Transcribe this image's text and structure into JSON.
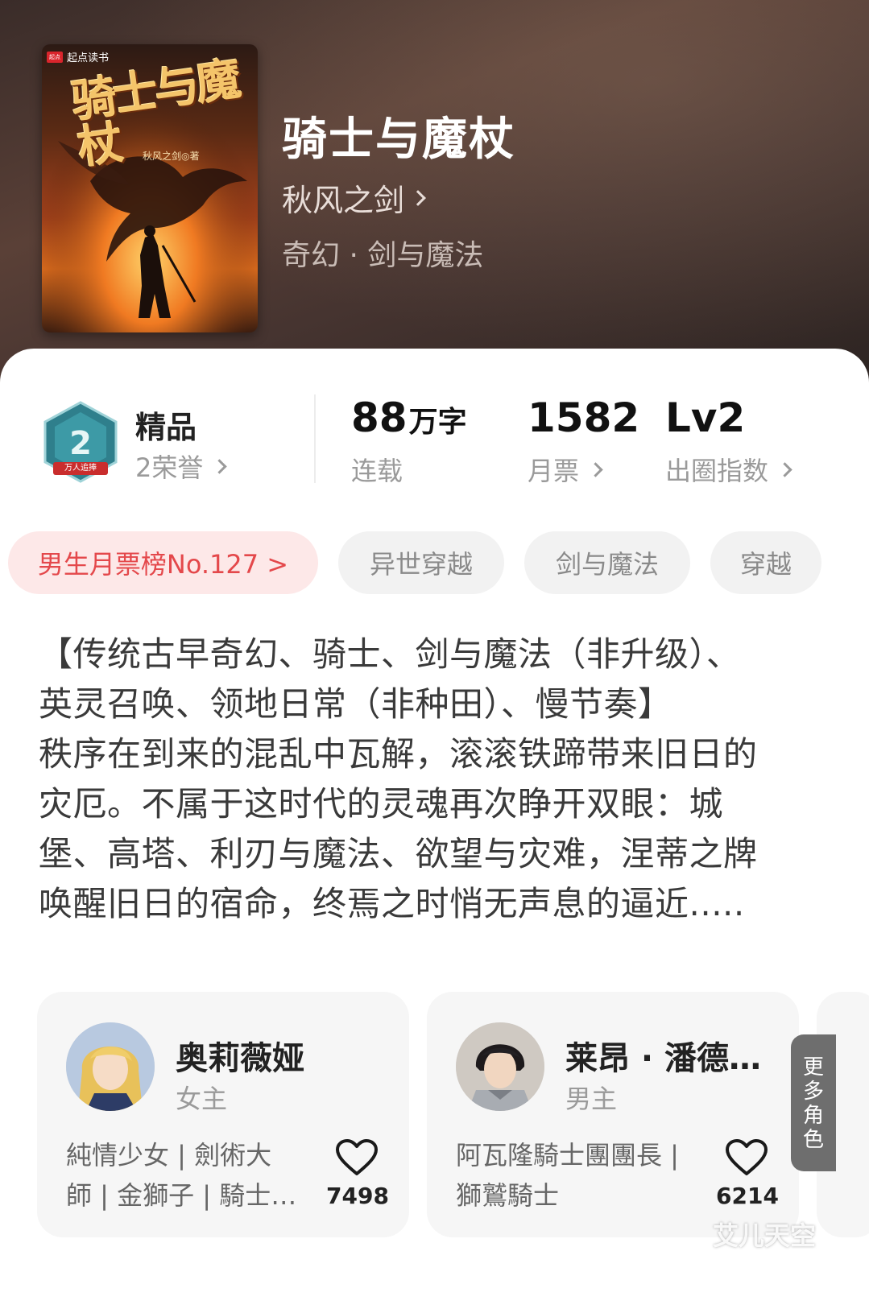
{
  "book": {
    "cover_publisher_logo": "起点",
    "cover_publisher": "起点读书",
    "cover_title": "骑士与魔杖",
    "cover_author": "秋风之剑◎著",
    "title": "骑士与魔杖",
    "author": "秋风之剑",
    "genre": "奇幻 · 剑与魔法"
  },
  "stats": {
    "badge_text": "万人追捧",
    "quality_title": "精品",
    "honor_label": "2荣誉",
    "words_value": "88",
    "words_unit": "万字",
    "words_label": "连载",
    "tickets_value": "1582",
    "tickets_label": "月票",
    "level_value": "Lv2",
    "level_label": "出圈指数"
  },
  "chips": {
    "rank": "男生月票榜No.127 >",
    "tag1": "异世穿越",
    "tag2": "剑与魔法",
    "tag3": "穿越"
  },
  "synopsis": {
    "line1": "【传统古早奇幻、骑士、剑与魔法（非升级）、",
    "line2": "英灵召唤、领地日常（非种田）、慢节奏】",
    "line3": "秩序在到来的混乱中瓦解，滚滚铁蹄带来旧日的",
    "line4": "灾厄。不属于这时代的灵魂再次睁开双眼：城",
    "line5": "堡、高塔、利刃与魔法、欲望与灾难，涅蒂之牌",
    "line6": "唤醒旧日的宿命，终焉之时悄无声息的逼近....."
  },
  "characters": [
    {
      "name": "奥莉薇娅",
      "role": "女主",
      "tags_line1": "純情少女 | 劍術大",
      "tags_line2": "師 | 金獅子 | 騎士…",
      "likes": "7498"
    },
    {
      "name": "莱昂 · 潘德…",
      "role": "男主",
      "tags_line1": "阿瓦隆騎士團團長 |",
      "tags_line2": "獅鷲騎士",
      "likes": "6214"
    }
  ],
  "more_roles": "更多角色",
  "watermark": "艾儿天空",
  "colors": {
    "rank_chip_text": "#e4484b",
    "rank_chip_bg": "#fde8e8",
    "header_bg": "#4a3632"
  }
}
